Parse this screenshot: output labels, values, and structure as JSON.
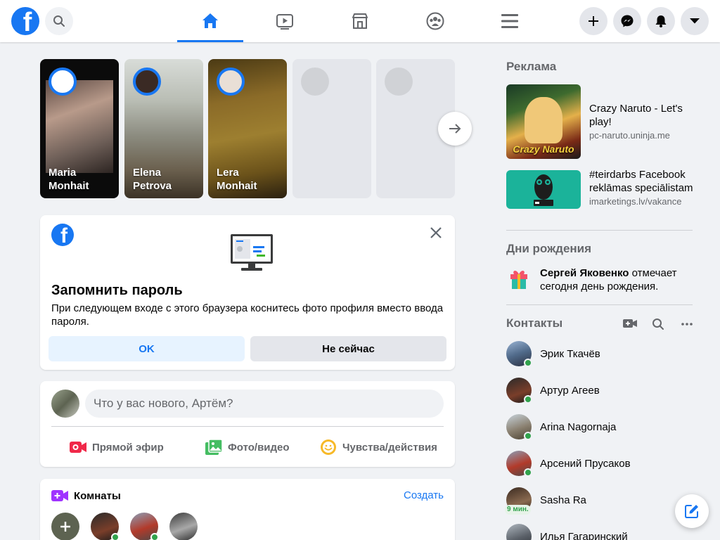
{
  "topbar": {
    "logo_letter": "f",
    "icons": [
      "facebook-logo-icon",
      "search-icon",
      "home-icon",
      "watch-icon",
      "marketplace-icon",
      "groups-icon",
      "menu-icon",
      "plus-icon",
      "messenger-icon",
      "notifications-icon",
      "account-dropdown-icon"
    ],
    "active_tab": "home",
    "accent_color": "#1877f2"
  },
  "stories": [
    {
      "first": "Maria",
      "last": "Monhait"
    },
    {
      "first": "Elena",
      "last": "Petrova"
    },
    {
      "first": "Lera",
      "last": "Monhait"
    }
  ],
  "remember_password": {
    "title": "Запомнить пароль",
    "text": "При следующем входе с этого браузера коснитесь фото профиля вместо ввода пароля.",
    "ok_label": "OK",
    "later_label": "Не сейчас"
  },
  "composer": {
    "placeholder": "Что у вас нового, Артём?",
    "live_label": "Прямой эфир",
    "photo_label": "Фото/видео",
    "feeling_label": "Чувства/действия"
  },
  "rooms": {
    "title": "Комнаты",
    "create_label": "Создать"
  },
  "sidebar": {
    "ads_title": "Реклама",
    "ads": [
      {
        "title": "Crazy Naruto - Let's play!",
        "url": "pc-naruto.uninja.me",
        "image_text": "Crazy Naruto"
      },
      {
        "title": "#teirdarbs Facebook reklāmas speciālistam",
        "url": "imarketings.lv/vakance"
      }
    ],
    "birthdays_title": "Дни рождения",
    "birthday_name": "Сергей Яковенко",
    "birthday_text": " отмечает сегодня день рождения.",
    "contacts_title": "Контакты",
    "contacts": [
      {
        "name": "Эрик Ткачёв",
        "status": "online"
      },
      {
        "name": "Артур Агеев",
        "status": "online"
      },
      {
        "name": "Arina Nagornaja",
        "status": "online"
      },
      {
        "name": "Арсений Прусаков",
        "status": "online"
      },
      {
        "name": "Sasha Ra",
        "status": "9 мин."
      },
      {
        "name": "Илья Гагаринский",
        "status": "online"
      }
    ]
  }
}
